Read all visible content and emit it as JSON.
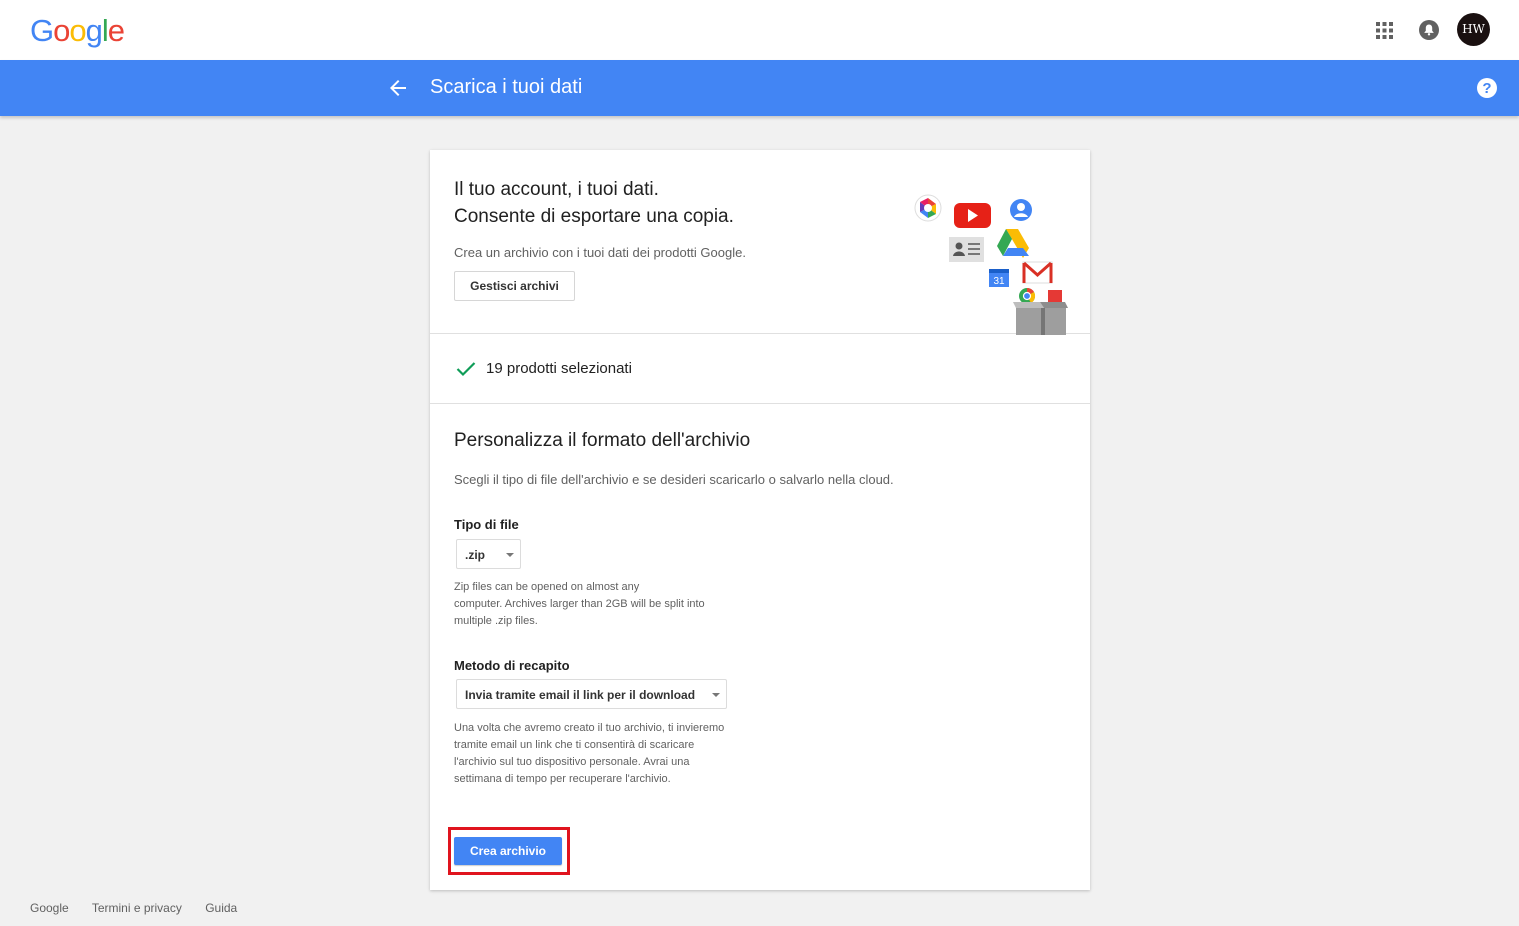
{
  "header": {
    "logo_letters": [
      "G",
      "o",
      "o",
      "g",
      "l",
      "e"
    ],
    "logo_colors": [
      "#4285f4",
      "#ea4335",
      "#fbbc05",
      "#4285f4",
      "#34a853",
      "#ea4335"
    ],
    "avatar_text": "HW"
  },
  "titlebar": {
    "title": "Scarica i tuoi dati",
    "background": "#4285f4"
  },
  "intro": {
    "headline_line1": "Il tuo account, i tuoi dati.",
    "headline_line2": "Consente di esportare una copia.",
    "description": "Crea un archivio con i tuoi dati dei prodotti Google.",
    "manage_button": "Gestisci archivi",
    "illustration_icons": [
      "picasa-icon",
      "youtube-icon",
      "profile-icon",
      "contacts-icon",
      "drive-icon",
      "calendar-icon",
      "gmail-icon",
      "chrome-icon",
      "archive-box-icon"
    ],
    "calendar_day": "31"
  },
  "products": {
    "selected_text": "19 prodotti selezionati"
  },
  "format": {
    "title": "Personalizza il formato dell'archivio",
    "description": "Scegli il tipo di file dell'archivio e se desideri scaricarlo o salvarlo nella cloud.",
    "file_type_label": "Tipo di file",
    "file_type_value": ".zip",
    "file_type_help": [
      "Zip files can be opened on almost any",
      "computer. Archives larger than 2GB will be split into",
      "multiple .zip files."
    ],
    "delivery_label": "Metodo di recapito",
    "delivery_value": "Invia tramite email il link per il download",
    "delivery_help": [
      "Una volta che avremo creato il tuo archivio, ti invieremo",
      "tramite email un link che ti consentirà di scaricare",
      "l'archivio sul tuo dispositivo personale. Avrai una",
      "settimana di tempo per recuperare l'archivio."
    ],
    "create_button": "Crea archivio",
    "highlight_color": "#e0141e"
  },
  "footer": {
    "links": [
      "Google",
      "Termini e privacy",
      "Guida"
    ]
  }
}
